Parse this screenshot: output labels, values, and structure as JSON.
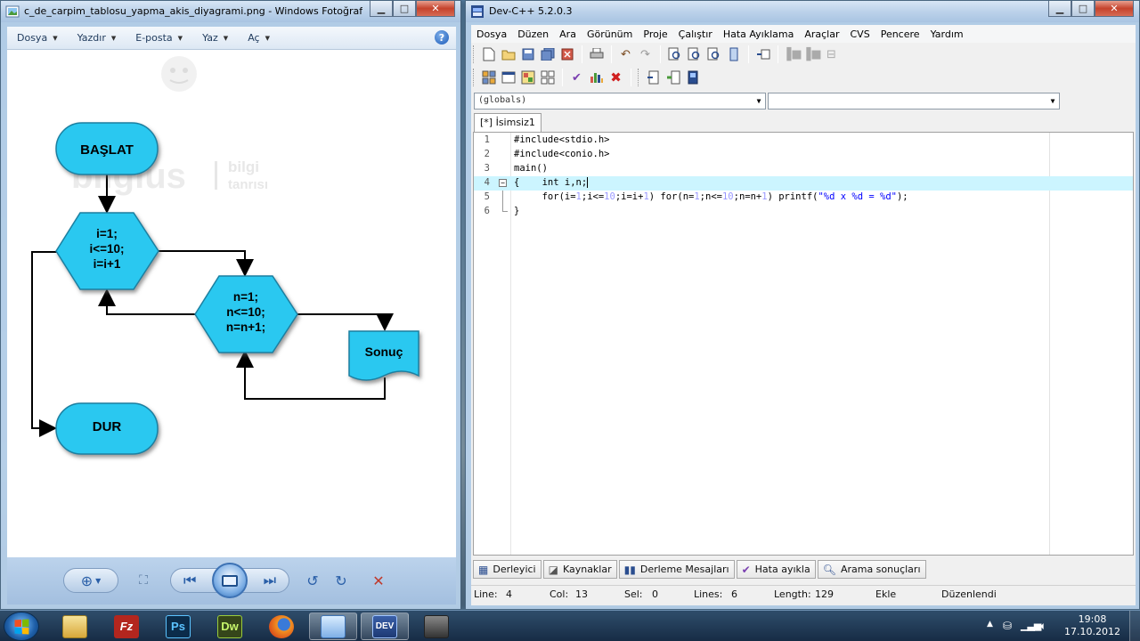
{
  "viewer": {
    "title": "c_de_carpim_tablosu_yapma_akis_diyagrami.png - Windows Fotoğraf Görün...",
    "menu": [
      "Dosya",
      "Yazdır",
      "E-posta",
      "Yaz",
      "Aç"
    ],
    "watermark": {
      "brand": "bilgius",
      "tag_top": "bilgi",
      "tag_bottom": "tanrısı"
    },
    "flowchart": {
      "start": "BAŞLAT",
      "loop_outer": [
        "i=1;",
        "i<=10;",
        "i=i+1"
      ],
      "loop_inner": [
        "n=1;",
        "n<=10;",
        "n=n+1;"
      ],
      "output": "Sonuç",
      "end": "DUR"
    }
  },
  "ide": {
    "title": "Dev-C++ 5.2.0.3",
    "menu": [
      "Dosya",
      "Düzen",
      "Ara",
      "Görünüm",
      "Proje",
      "Çalıştır",
      "Hata Ayıklama",
      "Araçlar",
      "CVS",
      "Pencere",
      "Yardım"
    ],
    "scope_combo": "(globals)",
    "symbol_combo": "",
    "tab": "[*] İsimsiz1",
    "code": [
      {
        "n": "1",
        "text": "#include<stdio.h>"
      },
      {
        "n": "2",
        "text": "#include<conio.h>"
      },
      {
        "n": "3",
        "text": "main()"
      },
      {
        "n": "4",
        "text": "{    int i,n;"
      },
      {
        "n": "5",
        "text": "     for(i=1;i<=10;i=i+1) for(n=1;n<=10;n=n+1) printf(\"%d x %d = %d\");"
      },
      {
        "n": "6",
        "text": "}"
      }
    ],
    "bottom_tabs": [
      "Derleyici",
      "Kaynaklar",
      "Derleme Mesajları",
      "Hata ayıkla",
      "Arama sonuçları"
    ],
    "status": {
      "line_label": "Line:",
      "line": "4",
      "col_label": "Col:",
      "col": "13",
      "sel_label": "Sel:",
      "sel": "0",
      "lines_label": "Lines:",
      "lines": "6",
      "length_label": "Length:",
      "length": "129",
      "mode": "Ekle",
      "state": "Düzenlendi"
    }
  },
  "taskbar": {
    "apps": [
      "Explorer",
      "FileZilla",
      "Ps",
      "Dw",
      "Firefox",
      "Fotoğraf Görüntüleyici",
      "DEV",
      "Kaydedici"
    ],
    "ps_label": "Ps",
    "dw_label": "Dw",
    "dev_label": "DEV",
    "fz_label": "Fz",
    "time": "19:08",
    "date": "17.10.2012"
  },
  "colors": {
    "flow_fill": "#2cc8f0",
    "flow_stroke": "#1a7fa0",
    "cur_line": "#ccf5ff",
    "preprocessor": "#008000",
    "number": "#9999ff",
    "string": "#0000ff"
  }
}
